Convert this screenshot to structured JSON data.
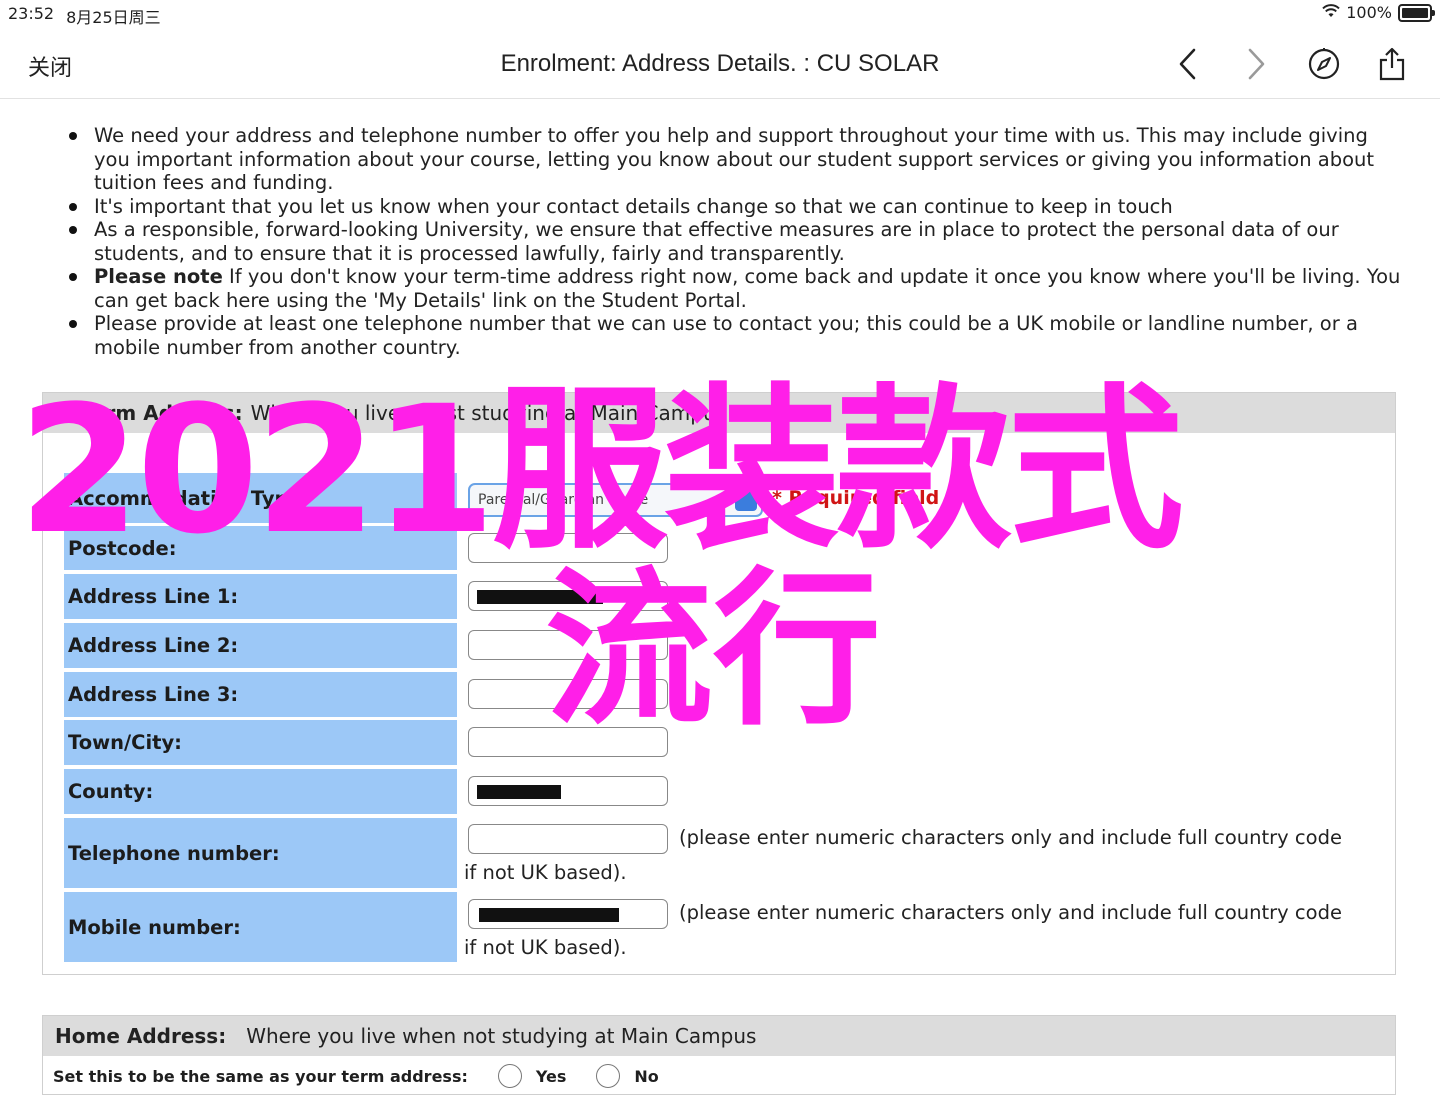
{
  "status_bar": {
    "time": "23:52",
    "date": "8月25日周三",
    "battery": "100%"
  },
  "nav": {
    "close_label": "关闭",
    "title": "Enrolment: Address Details. : CU SOLAR",
    "icons": [
      "back-chevron-icon",
      "forward-chevron-icon",
      "compass-icon",
      "share-icon"
    ]
  },
  "bullets": [
    {
      "bold": "",
      "text": "We need your address and telephone number to offer you help and support throughout your time with us. This may include giving you important information about your course, letting you know about our student support services or giving you information about tuition fees and funding."
    },
    {
      "bold": "",
      "text": "It's important that you let us know when your contact details change so that we can continue to keep in touch"
    },
    {
      "bold": "",
      "text": "As a responsible, forward-looking University, we ensure that effective measures are in place to protect the personal data of our students, and to ensure that it is processed lawfully, fairly and transparently."
    },
    {
      "bold": "Please note",
      "text": " If you don't know your term-time address right now, come back and update it once you know where you'll be living. You can get back here using the 'My Details' link on the Student Portal."
    },
    {
      "bold": "",
      "text": "Please provide at least one telephone number that we can use to contact you; this could be a UK mobile or landline number, or a mobile number from another country."
    }
  ],
  "term_address": {
    "title": "Term Address:",
    "subtitle": "Where you live whilst studying at Main Campus",
    "accommodation": {
      "label": "Accommodation Type:",
      "value": "Parental/Guardian home",
      "required": "* Required field"
    },
    "fields": {
      "postcode": "Postcode:",
      "line1": "Address Line 1:",
      "line2": "Address Line 2:",
      "line3": "Address Line 3:",
      "town": "Town/City:",
      "county": "County:",
      "telephone": "Telephone number:",
      "mobile": "Mobile number:"
    },
    "numeric_help": "(please enter numeric characters only and include full country code if not UK based)."
  },
  "home_address": {
    "title": "Home Address:",
    "subtitle": "Where you live when not studying at Main Campus",
    "same_label": "Set this to be the same as your term address:",
    "yes": "Yes",
    "no": "No"
  },
  "watermark": {
    "line1": "2021服装款式",
    "line2": "流行"
  },
  "colors": {
    "label_bg": "#9cc8f7",
    "panel_header_bg": "#dcdcdc",
    "watermark": "#ff1fe8",
    "required": "#d01515"
  }
}
